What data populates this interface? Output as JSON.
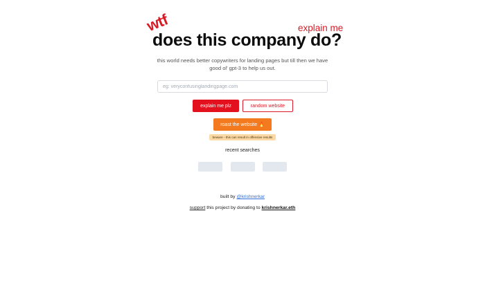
{
  "header": {
    "wtf": "wtf",
    "explain_me": "explain me",
    "title": "does this company do?"
  },
  "subtitle": "this world needs better copywriters for landing pages but till then we have good ol' gpt-3 to help us out.",
  "search": {
    "placeholder": "eg: veryconfusinglandingpage.com",
    "value": ""
  },
  "buttons": {
    "explain": "explain me plz",
    "random": "random website",
    "roast": "roast the website 🔥"
  },
  "warning": "beware - this can result in offensive results",
  "recent": {
    "label": "recent searches",
    "items": [
      "",
      "",
      ""
    ]
  },
  "footer": {
    "built_by_prefix": "built by",
    "author": "@krishnerkar",
    "support_link": "support",
    "support_middle": "this project by donating to",
    "donation_address": "krishnerkar.eth"
  },
  "colors": {
    "brand_red": "#e3101e",
    "roast_orange": "#f47a20",
    "warning_bg": "#fcd9a4",
    "chip_bg": "#e3e8ef",
    "link_blue": "#2f6fd6"
  }
}
